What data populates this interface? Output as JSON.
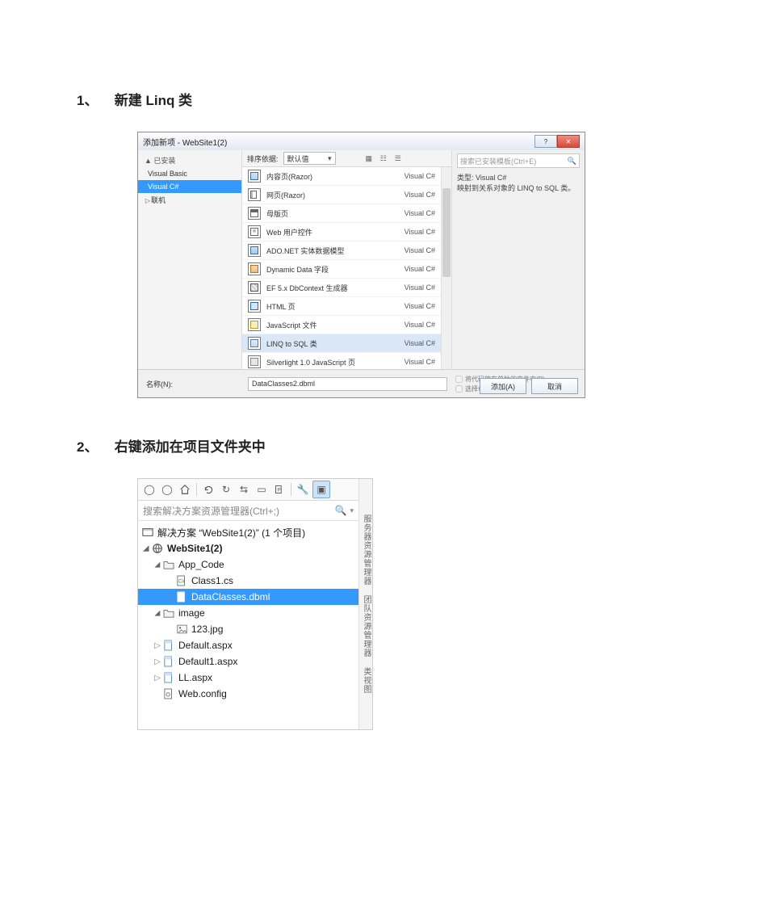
{
  "step1": {
    "num": "1、",
    "title": "新建 Linq 类"
  },
  "step2": {
    "num": "2、",
    "title": "右键添加在项目文件夹中"
  },
  "dlg1": {
    "title": "添加新项 - WebSite1(2)",
    "left": {
      "installed": "▲ 已安装",
      "languages": [
        "Visual Basic",
        "Visual C#"
      ],
      "online": "联机"
    },
    "toolbar": {
      "sortLabel": "排序依据:",
      "sortValue": "默认值"
    },
    "items": [
      {
        "label": "内容页(Razor)",
        "lang": "Visual C#",
        "icon": "razor"
      },
      {
        "label": "网页(Razor)",
        "lang": "Visual C#",
        "icon": "page"
      },
      {
        "label": "母版页",
        "lang": "Visual C#",
        "icon": "master"
      },
      {
        "label": "Web 用户控件",
        "lang": "Visual C#",
        "icon": "user"
      },
      {
        "label": "ADO.NET 实体数据模型",
        "lang": "Visual C#",
        "icon": "ado"
      },
      {
        "label": "Dynamic Data 字段",
        "lang": "Visual C#",
        "icon": "dd"
      },
      {
        "label": "EF 5.x DbContext 生成器",
        "lang": "Visual C#",
        "icon": "ef"
      },
      {
        "label": "HTML 页",
        "lang": "Visual C#",
        "icon": "html"
      },
      {
        "label": "JavaScript 文件",
        "lang": "Visual C#",
        "icon": "js"
      },
      {
        "label": "LINQ to SQL 类",
        "lang": "Visual C#",
        "icon": "linq",
        "selected": true
      },
      {
        "label": "Silverlight 1.0 JavaScript 页",
        "lang": "Visual C#",
        "icon": "silver"
      }
    ],
    "right": {
      "searchPlaceholder": "搜索已安装模板(Ctrl+E)",
      "descType": "类型: Visual C#",
      "descText": "映射到关系对象的 LINQ to SQL 类。"
    },
    "footer": {
      "nameLabel": "名称(N):",
      "nameValue": "DataClasses2.dbml",
      "opt1": "将代码放在单独的文件中(P)",
      "opt2": "选择母版页(C)",
      "add": "添加(A)",
      "cancel": "取消"
    }
  },
  "se": {
    "searchPlaceholder": "搜索解决方案资源管理器(Ctrl+;)",
    "solution": "解决方案 “WebSite1(2)” (1 个项目)",
    "project": "WebSite1(2)",
    "nodes": {
      "appCode": "App_Code",
      "class1": "Class1.cs",
      "dataClasses": "DataClasses.dbml",
      "image": "image",
      "img1": "123.jpg",
      "default": "Default.aspx",
      "default1": "Default1.aspx",
      "ll": "LL.aspx",
      "webconfig": "Web.config"
    },
    "sideText": "服务器资源管理器 团队资源管理器 类视图"
  }
}
